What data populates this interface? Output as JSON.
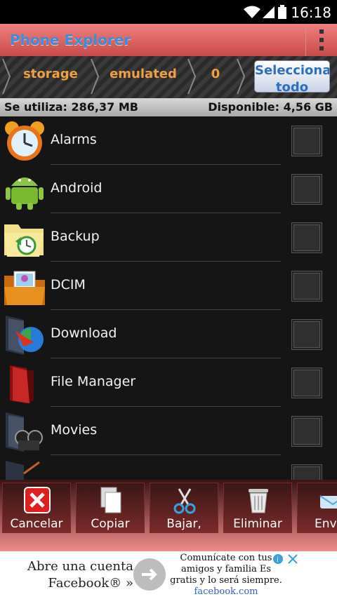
{
  "statusbar": {
    "time": "16:18"
  },
  "appbar": {
    "title": "Phone Explorer"
  },
  "breadcrumb": {
    "items": [
      "storage",
      "emulated",
      "0"
    ],
    "select_all": "Seleccionar todo"
  },
  "storage": {
    "used": "Se utiliza: 286,37 MB",
    "available": "Disponible: 4,56 GB"
  },
  "files": [
    {
      "name": "Alarms",
      "icon": "alarm-clock-icon"
    },
    {
      "name": "Android",
      "icon": "android-robot-icon"
    },
    {
      "name": "Backup",
      "icon": "backup-folder-icon"
    },
    {
      "name": "DCIM",
      "icon": "pictures-folder-icon"
    },
    {
      "name": "Download",
      "icon": "download-folder-icon"
    },
    {
      "name": "File Manager",
      "icon": "red-folder-icon"
    },
    {
      "name": "Movies",
      "icon": "movies-folder-icon"
    }
  ],
  "toolbar": {
    "cancel": "Cancelar",
    "copy": "Copiar",
    "cut": "Bajar,",
    "delete": "Eliminar",
    "send": "Env"
  },
  "ad": {
    "left_text": "Abre una cuenta Facebook® »",
    "right_text": "Comunícate con tus amigos y familia Es gratis y lo será siempre.",
    "url": "facebook.com"
  },
  "colors": {
    "appbar": "#e06a6a",
    "accent_text": "#f0a040",
    "title_blue": "#3a8fd8"
  }
}
